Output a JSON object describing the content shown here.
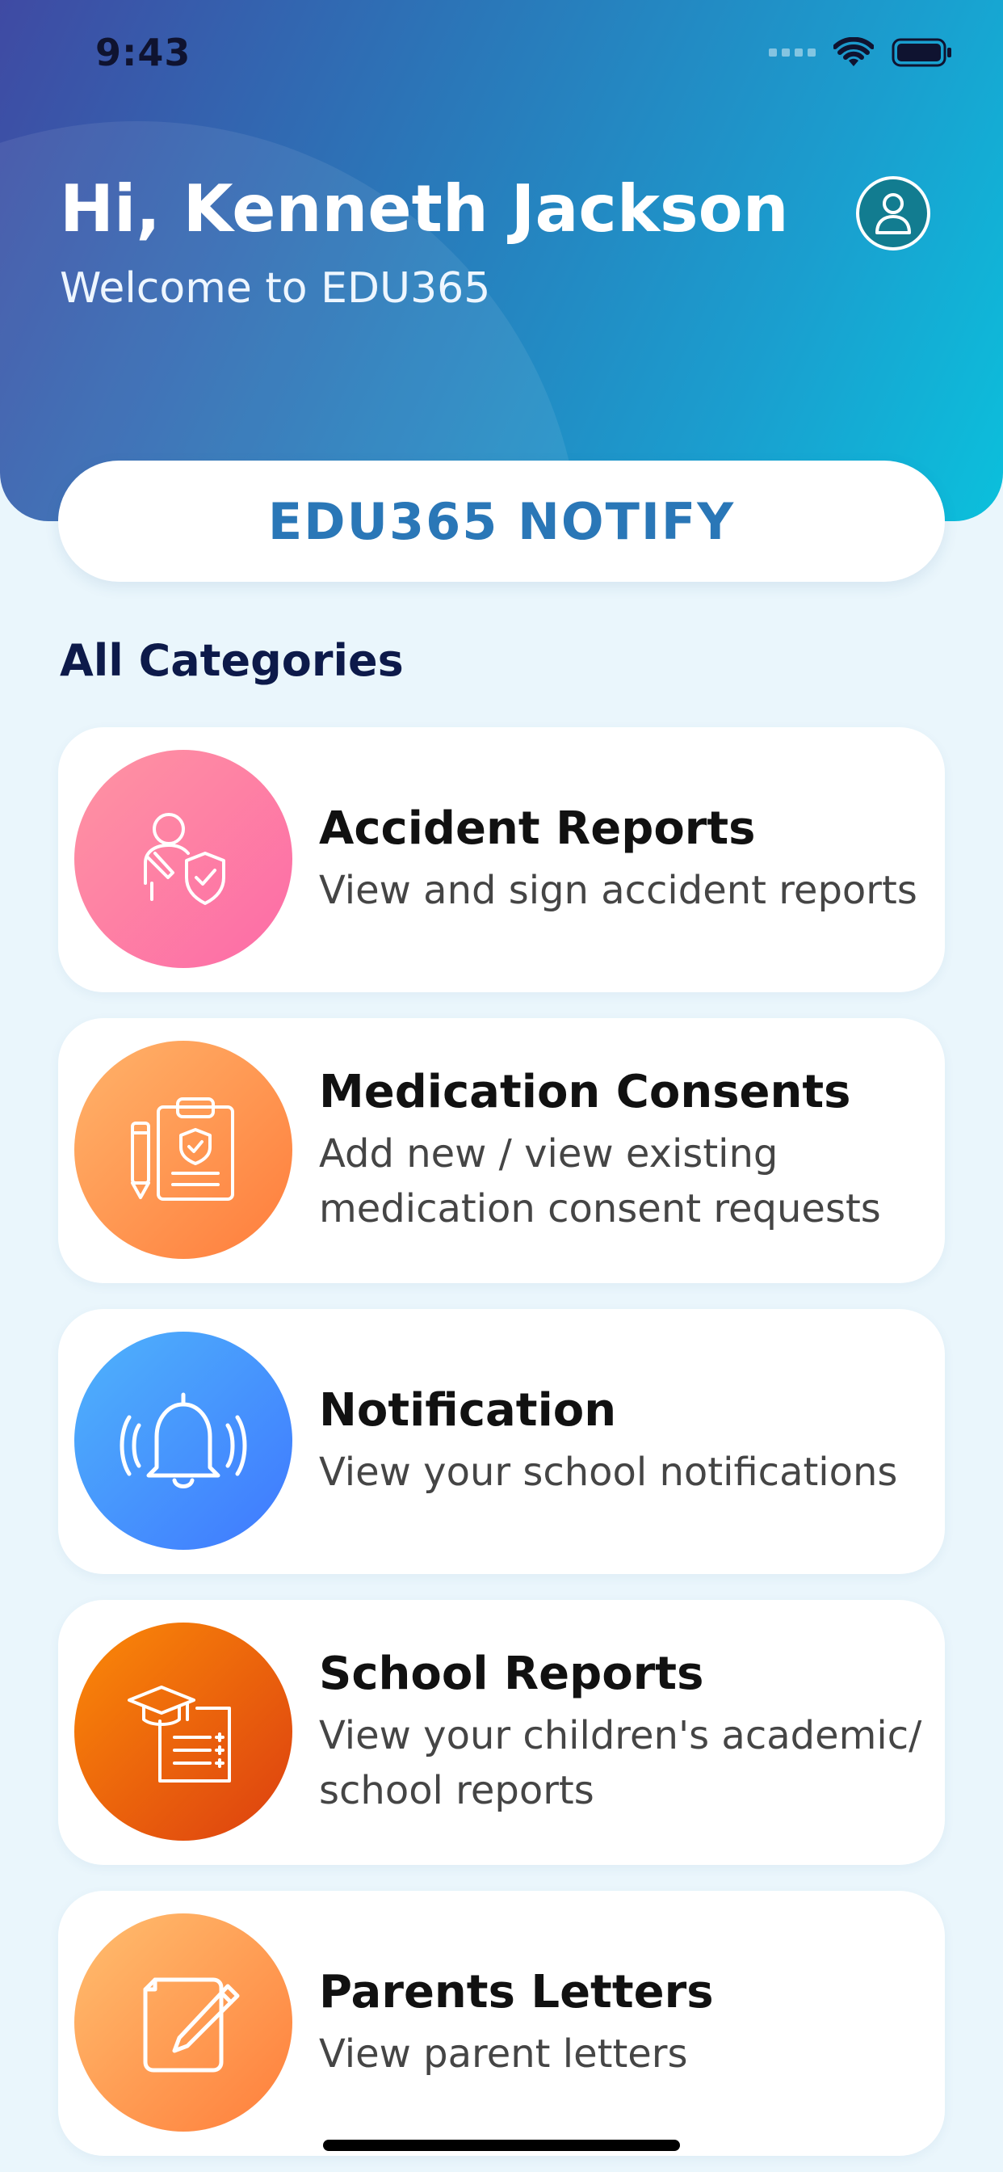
{
  "status_bar": {
    "time": "9:43",
    "icons": [
      "cellular-signal-icon",
      "wifi-icon",
      "battery-icon"
    ]
  },
  "header": {
    "greeting": "Hi, Kenneth Jackson",
    "welcome": "Welcome to EDU365",
    "profile_icon": "user-profile-icon"
  },
  "banner": {
    "label": "EDU365 NOTIFY"
  },
  "categories": {
    "title": "All Categories",
    "items": [
      {
        "title": "Accident Reports",
        "description": "View and sign accident reports",
        "icon": "injured-person-shield-icon",
        "colors": [
          "#fe94a2",
          "#fd6ba7"
        ]
      },
      {
        "title": "Medication Consents",
        "description": "Add new / view existing medication consent requests",
        "icon": "clipboard-pencil-icon",
        "colors": [
          "#ffb36a",
          "#ff7d3c"
        ]
      },
      {
        "title": "Notification",
        "description": "View your school notifications",
        "icon": "ringing-bell-icon",
        "colors": [
          "#4fb3fb",
          "#3f78ff"
        ]
      },
      {
        "title": "School Reports",
        "description": "View your children's academic/ school reports",
        "icon": "graduation-report-icon",
        "colors": [
          "#fb8a08",
          "#dc3f10"
        ]
      },
      {
        "title": "Parents Letters",
        "description": "View parent letters",
        "icon": "letter-pen-icon",
        "colors": [
          "#ffbe6f",
          "#ff7e3b"
        ]
      }
    ]
  },
  "colors": {
    "background": "#eaf6fc",
    "accent": "#2a77b7",
    "section_title": "#0d1a4a"
  }
}
